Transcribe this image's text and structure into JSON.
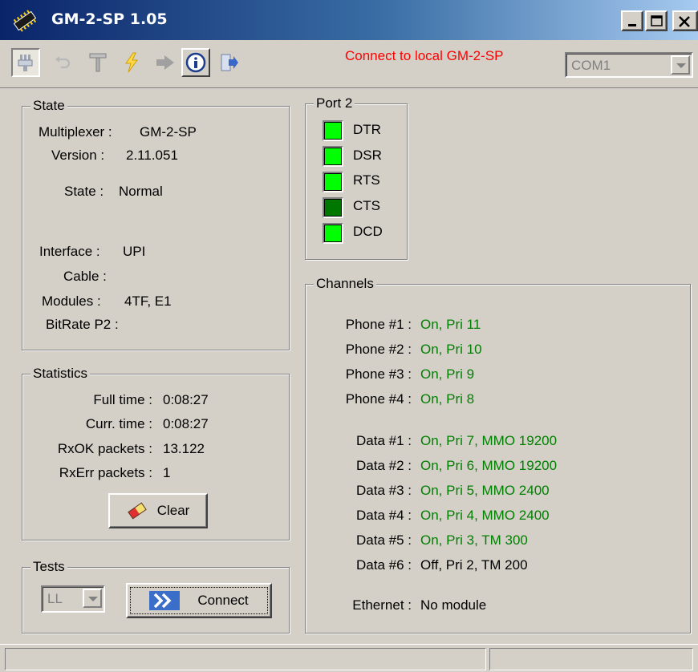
{
  "window": {
    "title": "GM-2-SP 1.05"
  },
  "toolbar": {
    "icons": [
      "plug-icon",
      "undo-icon",
      "tools-icon",
      "lightning-icon",
      "forward-arrow-icon",
      "info-icon",
      "exit-icon"
    ],
    "status_message": "Connect to local GM-2-SP",
    "port_select_value": "COM1"
  },
  "state": {
    "title": "State",
    "multiplexer_label": "Multiplexer :",
    "multiplexer_value": "GM-2-SP",
    "version_label": "Version :",
    "version_value": "2.11.051",
    "state_label": "State :",
    "state_value": "Normal",
    "interface_label": "Interface :",
    "interface_value": "UPI",
    "cable_label": "Cable :",
    "cable_value": "",
    "modules_label": "Modules :",
    "modules_value": "4TF, E1",
    "bitrate_label": "BitRate P2 :",
    "bitrate_value": ""
  },
  "statistics": {
    "title": "Statistics",
    "full_time_label": "Full time :",
    "full_time_value": "0:08:27",
    "curr_time_label": "Curr. time :",
    "curr_time_value": "0:08:27",
    "rxok_label": "RxOK packets :",
    "rxok_value": "13.122",
    "rxerr_label": "RxErr packets :",
    "rxerr_value": "1",
    "clear_label": "Clear"
  },
  "tests": {
    "title": "Tests",
    "mode_value": "LL",
    "connect_label": "Connect"
  },
  "port2": {
    "title": "Port 2",
    "signals": [
      {
        "name": "DTR",
        "color": "#00ff00"
      },
      {
        "name": "DSR",
        "color": "#00ff00"
      },
      {
        "name": "RTS",
        "color": "#00ff00"
      },
      {
        "name": "CTS",
        "color": "#007800"
      },
      {
        "name": "DCD",
        "color": "#00ff00"
      }
    ]
  },
  "channels": {
    "title": "Channels",
    "phones": [
      {
        "label": "Phone #1 :",
        "value": "On, Pri 11"
      },
      {
        "label": "Phone #2 :",
        "value": "On, Pri 10"
      },
      {
        "label": "Phone #3 :",
        "value": "On, Pri 9"
      },
      {
        "label": "Phone #4 :",
        "value": "On, Pri 8"
      }
    ],
    "data": [
      {
        "label": "Data #1 :",
        "value": "On, Pri 7, MMO 19200"
      },
      {
        "label": "Data #2 :",
        "value": "On, Pri 6, MMO 19200"
      },
      {
        "label": "Data #3 :",
        "value": "On, Pri 5, MMO 2400"
      },
      {
        "label": "Data #4 :",
        "value": "On, Pri 4, MMO 2400"
      },
      {
        "label": "Data #5 :",
        "value": "On, Pri 3, TM 300"
      },
      {
        "label": "Data #6 :",
        "value": "Off, Pri 2, TM 200"
      }
    ],
    "ethernet_label": "Ethernet :",
    "ethernet_value": "No module"
  },
  "colors": {
    "on": "#008000",
    "off": "#000000",
    "status_message": "#ff0000"
  }
}
